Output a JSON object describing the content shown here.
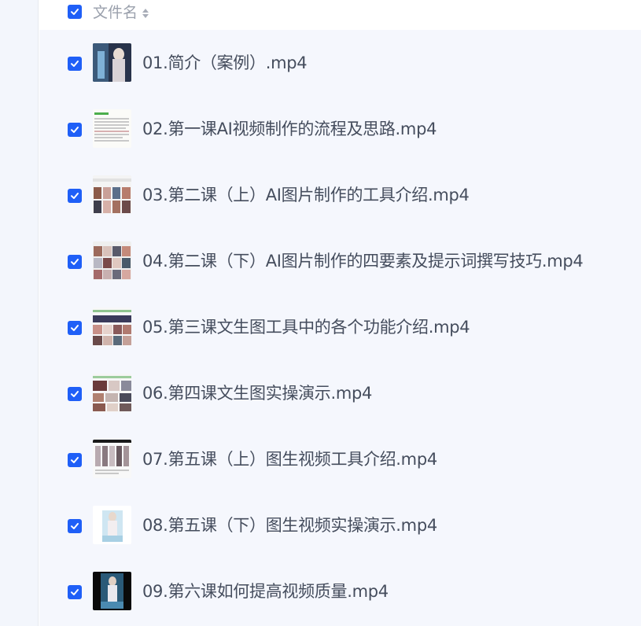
{
  "header": {
    "column_label": "文件名",
    "sort_icon": "sort-icon",
    "select_all_checked": true
  },
  "colors": {
    "accent": "#1f5ff7",
    "row_background": "#f5f7fd",
    "text": "#454d5d",
    "header_text": "#9aa0ac"
  },
  "files": [
    {
      "name": "01.简介（案例）.mp4",
      "checked": true
    },
    {
      "name": "02.第一课AI视频制作的流程及思路.mp4",
      "checked": true
    },
    {
      "name": "03.第二课（上）AI图片制作的工具介绍.mp4",
      "checked": true
    },
    {
      "name": "04.第二课（下）AI图片制作的四要素及提示词撰写技巧.mp4",
      "checked": true
    },
    {
      "name": "05.第三课文生图工具中的各个功能介绍.mp4",
      "checked": true
    },
    {
      "name": "06.第四课文生图实操演示.mp4",
      "checked": true
    },
    {
      "name": "07.第五课（上）图生视频工具介绍.mp4",
      "checked": true
    },
    {
      "name": "08.第五课（下）图生视频实操演示.mp4",
      "checked": true
    },
    {
      "name": "09.第六课如何提高视频质量.mp4",
      "checked": true
    }
  ]
}
